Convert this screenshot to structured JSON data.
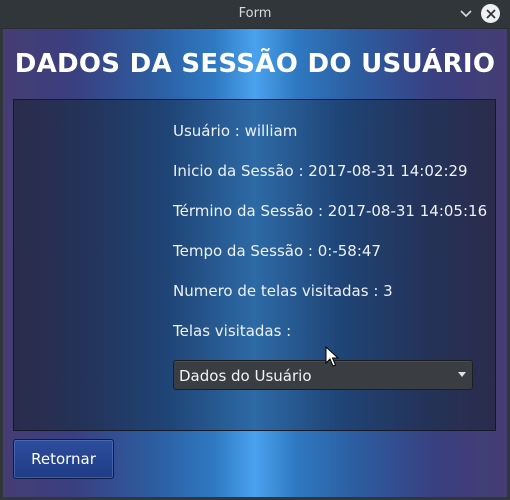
{
  "window": {
    "title": "Form",
    "icons": {
      "minimize": "chevron-down-icon",
      "close": "close-icon"
    }
  },
  "heading": "DADOS DA SESSÃO DO USUÁRIO",
  "session": {
    "user": "Usuário : william",
    "start": "Inicio da Sessão : 2017-08-31 14:02:29",
    "end": "Término da Sessão : 2017-08-31 14:05:16",
    "duration": "Tempo da Sessão : 0:-58:47",
    "screen_count": "Numero de telas visitadas : 3",
    "screens_label": "Telas visitadas :",
    "screens_selected": "Dados do Usuário"
  },
  "buttons": {
    "return": "Retornar"
  },
  "colors": {
    "accent": "#4aa2ee",
    "button": "#1e3c86"
  }
}
